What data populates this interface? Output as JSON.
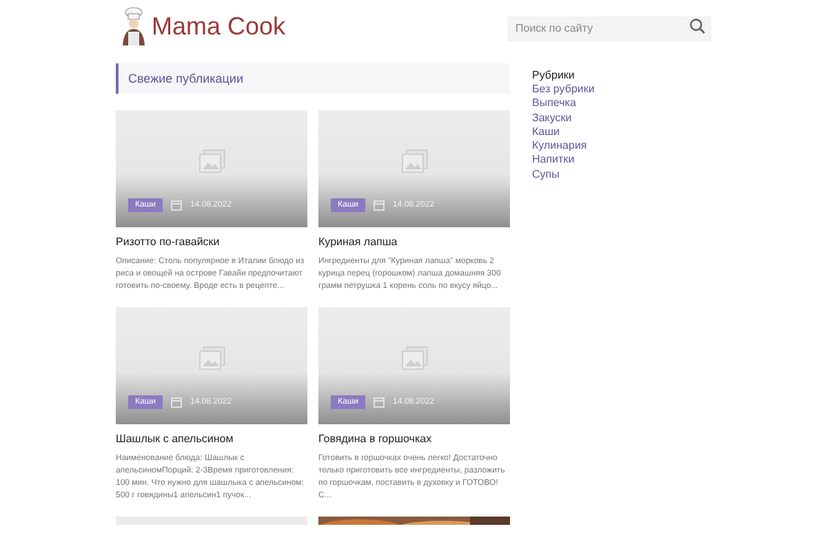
{
  "logo": {
    "text": "Mama Cook"
  },
  "search": {
    "placeholder": "Поиск по сайту"
  },
  "section_title": "Свежие публикации",
  "posts": [
    {
      "category": "Каши",
      "date": "14.08.2022",
      "title": "Ризотто по-гавайски",
      "excerpt": "Описание: Столь популярное в Италии блюдо из риса и овощей на острове Гавайи предпочитают готовить по-своему. Вроде есть в рецепте..."
    },
    {
      "category": "Каши",
      "date": "14.08.2022",
      "title": "Куриная лапша",
      "excerpt": "Ингредиенты для \"Куриная лапша\" морковь 2 курица перец (горошком) лапша домашняя 300 грамм петрушка 1 корень соль по вкусу яйцо..."
    },
    {
      "category": "Каши",
      "date": "14.08.2022",
      "title": "Шашлык с апельсином",
      "excerpt": "Наименование блюда: Шашлык с апельсиномПорций: 2-3Время приготовления: 100 мин. Что нужно для шашлыка с апельсином: 500 г говядины1 апельсин1 пучок..."
    },
    {
      "category": "Каши",
      "date": "14.08.2022",
      "title": "Говядина в горшочках",
      "excerpt": "Готовить в горшочках очень легко! Достаточно только приготовить  все  ингредиенты, разложить по горшочкам, поставить в духовку и ГОТОВО! С..."
    }
  ],
  "more_posts": [
    {
      "kind": "placeholder"
    },
    {
      "kind": "picture"
    }
  ],
  "sidebar": {
    "title": "Рубрики",
    "items": [
      "Без рубрики",
      "Выпечка",
      "Закуски",
      "Каши",
      "Кулинария",
      "Напитки",
      "Супы"
    ]
  }
}
